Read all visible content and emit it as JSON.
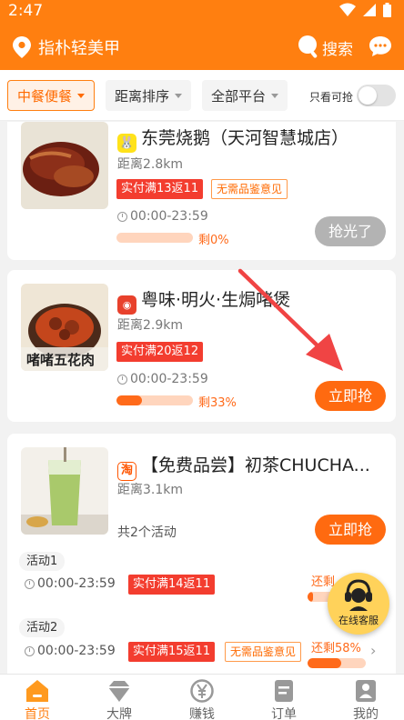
{
  "status": {
    "time": "2:47"
  },
  "header": {
    "location": "指朴轻美甲",
    "search_label": "搜索"
  },
  "filters": {
    "cuisine": "中餐便餐",
    "sort": "距离排序",
    "platform": "全部平台",
    "only_available": "只看可抢"
  },
  "shops": [
    {
      "name": "东莞烧鹅（天河智慧城店）",
      "distance": "距离2.8km",
      "promo": "实付满13返11",
      "note": "无需品鉴意见",
      "hours": "00:00-23:59",
      "remain": "剩0%",
      "remain_fraction": 0.0,
      "button": "抢光了"
    },
    {
      "name": "粤味·明火·生焗啫煲",
      "distance": "距离2.9km",
      "promo": "实付满20返12",
      "hours": "00:00-23:59",
      "remain": "剩33%",
      "remain_fraction": 0.33,
      "button": "立即抢"
    },
    {
      "name": "【免费品尝】初茶CHUCHA...",
      "distance": "距离3.1km",
      "count": "共2个活动",
      "button": "立即抢",
      "platform_badge": "淘",
      "activities": [
        {
          "label": "活动1",
          "hours": "00:00-23:59",
          "promo": "实付满14返11",
          "remain": "还剩",
          "remain_fraction": 0.1
        },
        {
          "label": "活动2",
          "hours": "00:00-23:59",
          "promo": "实付满15返11",
          "note": "无需品鉴意见",
          "remain": "还剩58%",
          "remain_fraction": 0.58
        }
      ]
    }
  ],
  "service": {
    "label": "在线客服"
  },
  "tabs": [
    {
      "label": "首页"
    },
    {
      "label": "大牌"
    },
    {
      "label": "赚钱"
    },
    {
      "label": "订单"
    },
    {
      "label": "我的"
    }
  ],
  "colors": {
    "brand": "#ff7f10",
    "promo": "#f33d2f",
    "disabled": "#b3b3b3"
  }
}
